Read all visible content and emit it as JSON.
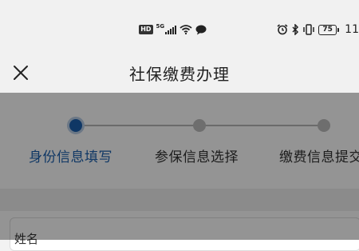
{
  "status_bar": {
    "hd_badge": "HD",
    "network_label": "5G",
    "battery_level": "75",
    "clock": "11",
    "icons": [
      "hd-icon",
      "signal-icon",
      "wifi-icon",
      "message-icon",
      "alarm-icon",
      "bluetooth-icon",
      "vibrate-icon",
      "battery-icon"
    ]
  },
  "header": {
    "close_icon": "close-icon",
    "title": "社保缴费办理"
  },
  "stepper": {
    "steps": [
      {
        "label": "身份信息填写",
        "state": "active"
      },
      {
        "label": "参保信息选择",
        "state": "pending"
      },
      {
        "label": "缴费信息提交",
        "state": "pending"
      }
    ]
  },
  "form": {
    "first_field_label": "姓名"
  },
  "colors": {
    "accent": "#1a5fae",
    "inactive": "#bdbdbd",
    "overlay": "rgba(0,0,0,0.42)"
  }
}
